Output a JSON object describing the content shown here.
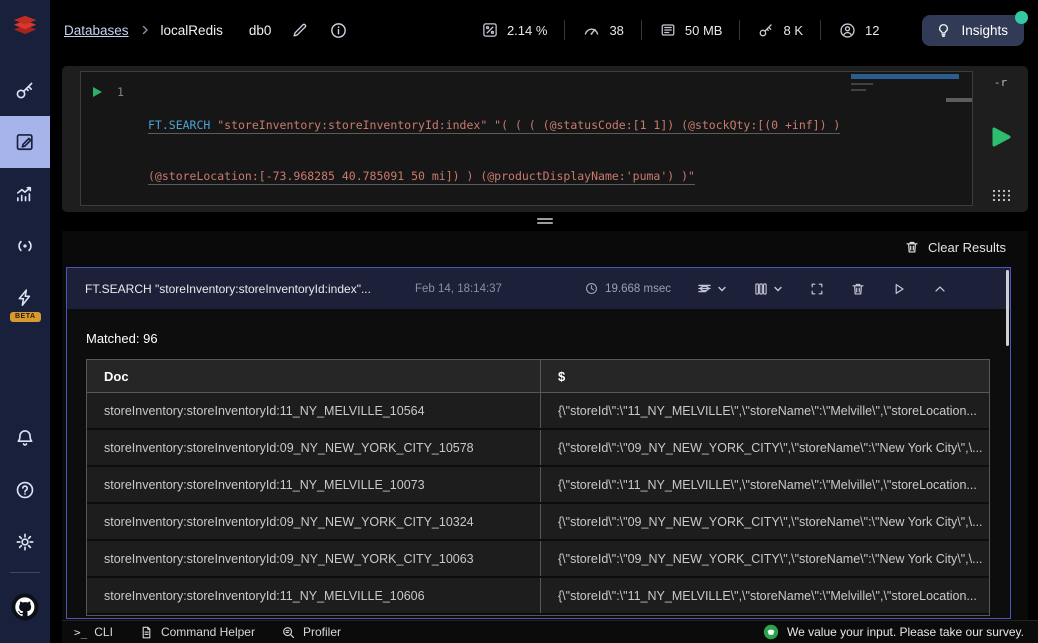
{
  "app": {
    "title": "RedisInsight Workbench"
  },
  "colors": {
    "sidebar_bg": "#18203c",
    "sidebar_active": "#a7b4ec",
    "accent_border": "#4d55b8",
    "run_green": "#2fae68",
    "insights_dot": "#35c7a4",
    "keyword_blue": "#4ba3d3",
    "string_salmon": "#c97a6d",
    "beta_badge": "#d79a2e",
    "survey_green": "#2ba24c"
  },
  "sidebar": {
    "beta_label": "BETA",
    "items": [
      {
        "name": "browser",
        "icon": "key-icon"
      },
      {
        "name": "workbench",
        "icon": "edit-icon",
        "active": true
      },
      {
        "name": "analysis-tools",
        "icon": "stats-icon"
      },
      {
        "name": "pub-sub",
        "icon": "pubsub-icon"
      },
      {
        "name": "triggers-and-functions",
        "icon": "lightning-icon",
        "badge": "BETA"
      }
    ],
    "bottom_items": [
      {
        "name": "notifications",
        "icon": "bell-icon"
      },
      {
        "name": "help",
        "icon": "question-icon"
      },
      {
        "name": "settings",
        "icon": "gear-icon"
      },
      {
        "name": "github",
        "icon": "github-icon"
      }
    ]
  },
  "header": {
    "breadcrumb": {
      "databases": "Databases",
      "database": "localRedis",
      "db_index": "db0"
    },
    "metrics": [
      {
        "icon": "cpu-icon",
        "value": "2.14 %"
      },
      {
        "icon": "commands-per-sec-icon",
        "value": "38"
      },
      {
        "icon": "memory-icon",
        "value": "50 MB"
      },
      {
        "icon": "total-keys-icon",
        "value": "8 K"
      },
      {
        "icon": "connected-clients-icon",
        "value": "12"
      }
    ],
    "insights_label": "Insights"
  },
  "editor": {
    "line_number": "1",
    "keyword": "FT.SEARCH",
    "line1_rest": " \"storeInventory:storeInventoryId:index\" \"( ( ( (@statusCode:[1 1]) (@stockQty:[(0 +inf]) )",
    "line2": "(@storeLocation:[-73.968285 40.785091 50 mi]) ) (@productDisplayName:'puma') )\"",
    "raw_mode_flag": "-r"
  },
  "results": {
    "clear_label": "Clear Results",
    "card": {
      "query": "FT.SEARCH \"storeInventory:storeInventoryId:index\"...",
      "timestamp": "Feb 14, 18:14:37",
      "duration": "19.668 msec",
      "matched_label": "Matched: 96",
      "table": {
        "columns": [
          "Doc",
          "$"
        ],
        "rows": [
          {
            "doc": "storeInventory:storeInventoryId:11_NY_MELVILLE_10564",
            "value": "{\\\"storeId\\\":\\\"11_NY_MELVILLE\\\",\\\"storeName\\\":\\\"Melville\\\",\\\"storeLocation..."
          },
          {
            "doc": "storeInventory:storeInventoryId:09_NY_NEW_YORK_CITY_10578",
            "value": "{\\\"storeId\\\":\\\"09_NY_NEW_YORK_CITY\\\",\\\"storeName\\\":\\\"New York City\\\",\\..."
          },
          {
            "doc": "storeInventory:storeInventoryId:11_NY_MELVILLE_10073",
            "value": "{\\\"storeId\\\":\\\"11_NY_MELVILLE\\\",\\\"storeName\\\":\\\"Melville\\\",\\\"storeLocation..."
          },
          {
            "doc": "storeInventory:storeInventoryId:09_NY_NEW_YORK_CITY_10324",
            "value": "{\\\"storeId\\\":\\\"09_NY_NEW_YORK_CITY\\\",\\\"storeName\\\":\\\"New York City\\\",\\..."
          },
          {
            "doc": "storeInventory:storeInventoryId:09_NY_NEW_YORK_CITY_10063",
            "value": "{\\\"storeId\\\":\\\"09_NY_NEW_YORK_CITY\\\",\\\"storeName\\\":\\\"New York City\\\",\\..."
          },
          {
            "doc": "storeInventory:storeInventoryId:11_NY_MELVILLE_10606",
            "value": "{\\\"storeId\\\":\\\"11_NY_MELVILLE\\\",\\\"storeName\\\":\\\"Melville\\\",\\\"storeLocation..."
          }
        ]
      }
    }
  },
  "bottom_bar": {
    "cli_label": "CLI",
    "command_helper_label": "Command Helper",
    "profiler_label": "Profiler",
    "survey_label": "We value your input. Please take our survey."
  }
}
